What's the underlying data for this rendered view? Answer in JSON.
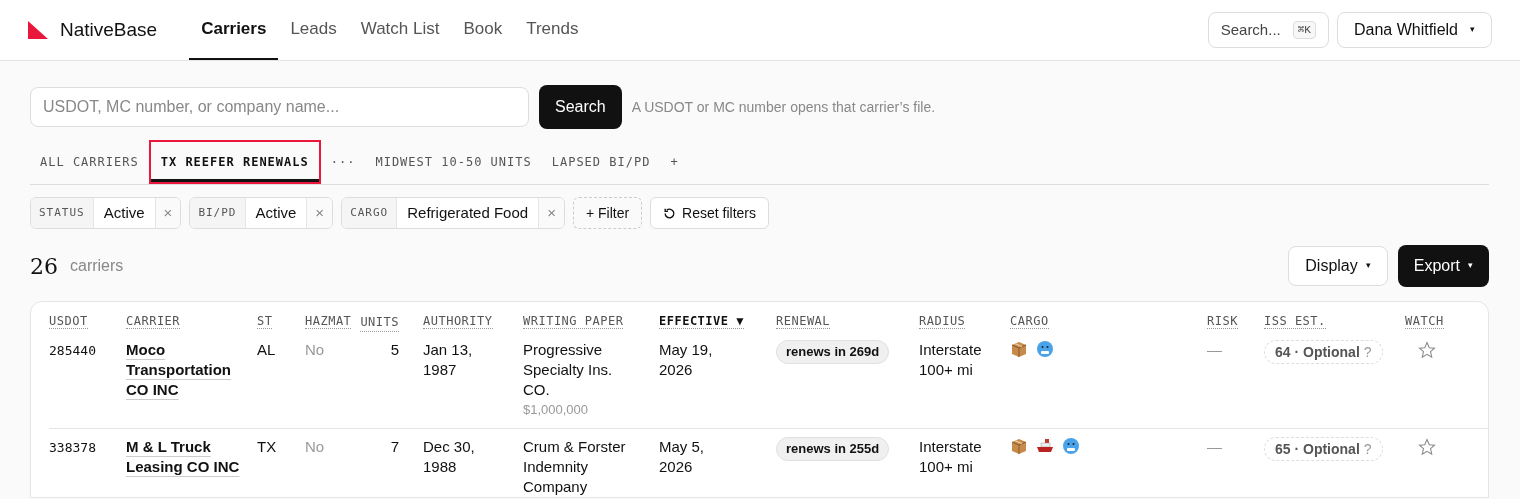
{
  "brand": {
    "name": "NativeBase"
  },
  "nav": [
    {
      "label": "Carriers",
      "selected": true
    },
    {
      "label": "Leads",
      "selected": false
    },
    {
      "label": "Watch List",
      "selected": false
    },
    {
      "label": "Book",
      "selected": false
    },
    {
      "label": "Trends",
      "selected": false
    }
  ],
  "header_search": {
    "placeholder": "Search...",
    "shortcut": "⌘K"
  },
  "user_menu": {
    "name": "Dana Whitfield",
    "caret": "▾"
  },
  "lookup": {
    "placeholder": "USDOT, MC number, or company name...",
    "button": "Search",
    "hint": "A USDOT or MC number opens that carrier’s file."
  },
  "views": [
    {
      "label": "ALL CARRIERS",
      "selected": false
    },
    {
      "label": "TX REEFER RENEWALS",
      "selected": true
    },
    {
      "label": "···",
      "selected": false
    },
    {
      "label": "MIDWEST 10-50 UNITS",
      "selected": false
    },
    {
      "label": "LAPSED BI/PD",
      "selected": false
    },
    {
      "label": "+",
      "selected": false
    }
  ],
  "filters": [
    {
      "field": "STATUS",
      "value": "Active",
      "remove": "×"
    },
    {
      "field": "BI/PD",
      "value": "Active",
      "remove": "×"
    },
    {
      "field": "CARGO",
      "value": "Refrigerated Food",
      "remove": "×"
    }
  ],
  "add_filter": "+ Filter",
  "reset_filters": "Reset filters",
  "count": {
    "number": "26",
    "label": "carriers"
  },
  "display_button": {
    "label": "Display",
    "caret": "▾"
  },
  "export_button": {
    "label": "Export",
    "caret": "▾"
  },
  "table": {
    "columns": [
      {
        "label": "USDOT",
        "sorted": false
      },
      {
        "label": "CARRIER",
        "sorted": false
      },
      {
        "label": "ST",
        "sorted": false
      },
      {
        "label": "HAZMAT",
        "sorted": false
      },
      {
        "label": "UNITS",
        "sorted": false
      },
      {
        "label": "AUTHORITY",
        "sorted": false
      },
      {
        "label": "WRITING PAPER",
        "sorted": false
      },
      {
        "label": "EFFECTIVE",
        "sorted": true,
        "sort_indicator": "▼"
      },
      {
        "label": "RENEWAL",
        "sorted": false
      },
      {
        "label": "RADIUS",
        "sorted": false
      },
      {
        "label": "CARGO",
        "sorted": false
      },
      {
        "label": "RISK",
        "sorted": false
      },
      {
        "label": "ISS EST.",
        "sorted": false
      },
      {
        "label": "WATCH",
        "sorted": false
      }
    ],
    "rows": [
      {
        "usdot": "285440",
        "carrier": "Moco Transportation CO INC",
        "st": "AL",
        "hazmat": "No",
        "units": "5",
        "authority": "Jan 13, 1987",
        "writing_paper": "Progressive Specialty Ins. CO.",
        "limit": "$1,000,000",
        "effective": "May 19, 2026",
        "renewal": "renews in 269d",
        "radius": "Interstate 100+ mi",
        "cargo": [
          {
            "kind": "box"
          },
          {
            "kind": "cold"
          }
        ],
        "risk": "—",
        "iss_est": "64 · Optional",
        "iss_help": "?",
        "watched": false
      },
      {
        "usdot": "338378",
        "carrier": "M & L Truck Leasing CO INC",
        "st": "TX",
        "hazmat": "No",
        "units": "7",
        "authority": "Dec 30, 1988",
        "writing_paper": "Crum & Forster Indemnity Company",
        "effective": "May 5, 2026",
        "renewal": "renews in 255d",
        "radius": "Interstate 100+ mi",
        "cargo": [
          {
            "kind": "box"
          },
          {
            "kind": "ship"
          },
          {
            "kind": "cold"
          }
        ],
        "risk": "—",
        "iss_est": "65 · Optional",
        "iss_help": "?",
        "watched": false
      }
    ]
  }
}
